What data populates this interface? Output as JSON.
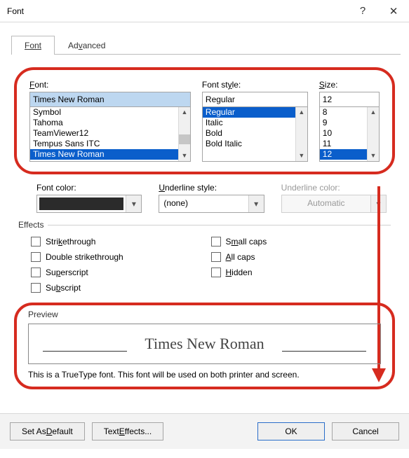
{
  "title": "Font",
  "help_symbol": "?",
  "close_symbol": "✕",
  "tabs": {
    "font": "Font",
    "advanced": "Advanced"
  },
  "font": {
    "label_html": "F",
    "label_rest": "ont:",
    "value": "Times New Roman",
    "options": [
      "Symbol",
      "Tahoma",
      "TeamViewer12",
      "Tempus Sans ITC",
      "Times New Roman"
    ],
    "selected_index": 4
  },
  "style": {
    "label": "Font style:",
    "value": "Regular",
    "options": [
      "Regular",
      "Italic",
      "Bold",
      "Bold Italic"
    ],
    "selected_index": 0
  },
  "size": {
    "label_u": "S",
    "label_rest": "ize:",
    "value": "12",
    "options": [
      "8",
      "9",
      "10",
      "11",
      "12"
    ],
    "selected_index": 4
  },
  "row2": {
    "fontcolor": "Font color:",
    "underline_u": "U",
    "underline_rest": "nderline style:",
    "underline_value": "(none)",
    "ucolor_label": "Underline color:",
    "ucolor_value": "Automatic"
  },
  "effects": {
    "heading": "Effects",
    "strike_u": "S",
    "strike_rest": "trikethrough",
    "dstrike": "Double strikethrough",
    "super_rest": "Superscript",
    "sub": "Subscript",
    "smallcaps_u": "S",
    "smallcaps_rest": "mall caps",
    "allcaps_u": "A",
    "allcaps_rest": "ll caps",
    "hidden_u": "H",
    "hidden_rest": "idden"
  },
  "preview": {
    "heading": "Preview",
    "sample": "Times New Roman",
    "desc": "This is a TrueType font. This font will be used on both printer and screen."
  },
  "buttons": {
    "setdefault": "Set As Default",
    "texteffects": "Text Effects...",
    "ok": "OK",
    "cancel": "Cancel"
  }
}
